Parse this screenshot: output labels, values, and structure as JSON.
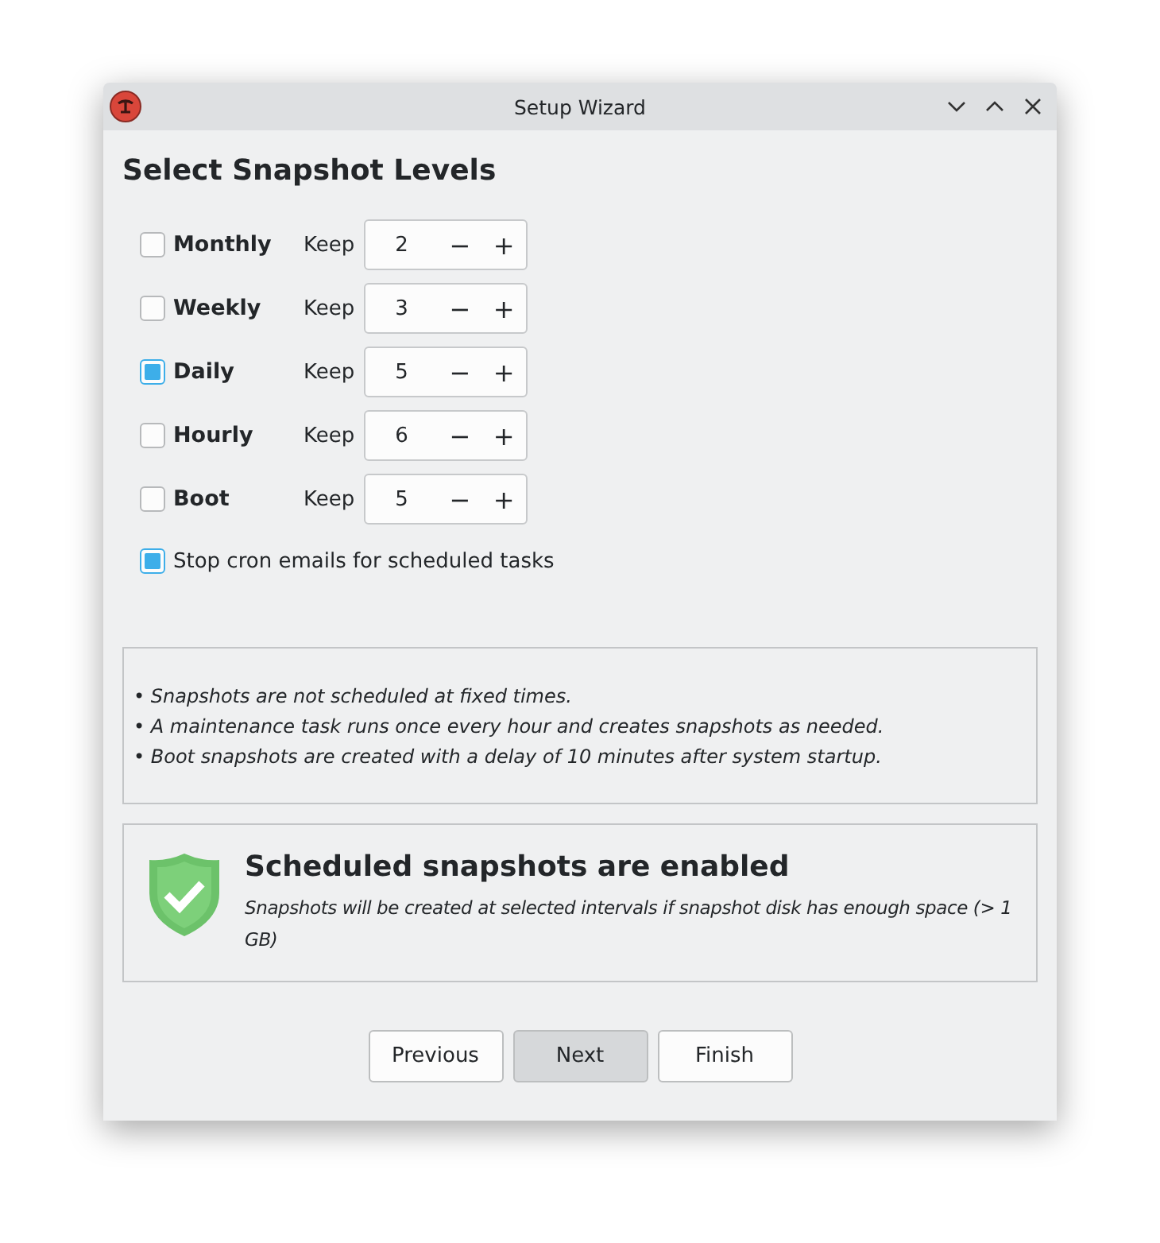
{
  "window": {
    "title": "Setup Wizard"
  },
  "heading": "Select Snapshot Levels",
  "levels": [
    {
      "label": "Monthly",
      "checked": false,
      "keep_label": "Keep",
      "value": "2",
      "minus": "−",
      "plus": "+"
    },
    {
      "label": "Weekly",
      "checked": false,
      "keep_label": "Keep",
      "value": "3",
      "minus": "−",
      "plus": "+"
    },
    {
      "label": "Daily",
      "checked": true,
      "keep_label": "Keep",
      "value": "5",
      "minus": "−",
      "plus": "+"
    },
    {
      "label": "Hourly",
      "checked": false,
      "keep_label": "Keep",
      "value": "6",
      "minus": "−",
      "plus": "+"
    },
    {
      "label": "Boot",
      "checked": false,
      "keep_label": "Keep",
      "value": "5",
      "minus": "−",
      "plus": "+"
    }
  ],
  "cron_option": {
    "label": "Stop cron emails for scheduled tasks",
    "checked": true
  },
  "notes": [
    "• Snapshots are not scheduled at fixed times.",
    "• A maintenance task runs once every hour and creates snapshots as needed.",
    "• Boot snapshots are created with a delay of 10 minutes after system startup."
  ],
  "status": {
    "title": "Scheduled snapshots are enabled",
    "message": "Snapshots will be created at selected intervals if snapshot disk has enough space (> 1 GB)"
  },
  "buttons": [
    {
      "label": "Previous",
      "pressed": false
    },
    {
      "label": "Next",
      "pressed": true
    },
    {
      "label": "Finish",
      "pressed": false
    }
  ]
}
